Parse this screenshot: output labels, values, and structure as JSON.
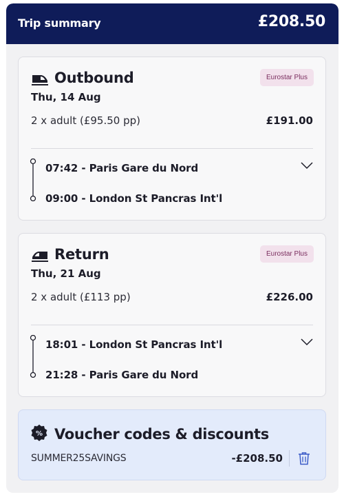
{
  "header": {
    "title": "Trip summary",
    "total": "£208.50",
    "color": "#0f1c59"
  },
  "outbound": {
    "icon": "train-icon",
    "title": "Outbound",
    "badge": "Eurostar Plus",
    "date": "Thu, 14 Aug",
    "passengers": "2 x adult (£95.50 pp)",
    "price": "£191.00",
    "departure": "07:42 - Paris Gare du Nord",
    "arrival": "09:00 - London St Pancras Int'l"
  },
  "return": {
    "icon": "train-icon",
    "title": "Return",
    "badge": "Eurostar Plus",
    "date": "Thu, 21 Aug",
    "passengers": "2 x adult (£113 pp)",
    "price": "£226.00",
    "departure": "18:01 - London St Pancras Int'l",
    "arrival": "21:28 - Paris Gare du Nord"
  },
  "voucher": {
    "icon": "discount-icon",
    "title": "Voucher codes & discounts",
    "code": "SUMMER25SAVINGS",
    "amount": "-£208.50",
    "remove_icon": "trash-icon",
    "background": "#e3ebfb"
  },
  "badge_colors": {
    "background": "#f2e1ec",
    "text": "#7a2d5e"
  }
}
